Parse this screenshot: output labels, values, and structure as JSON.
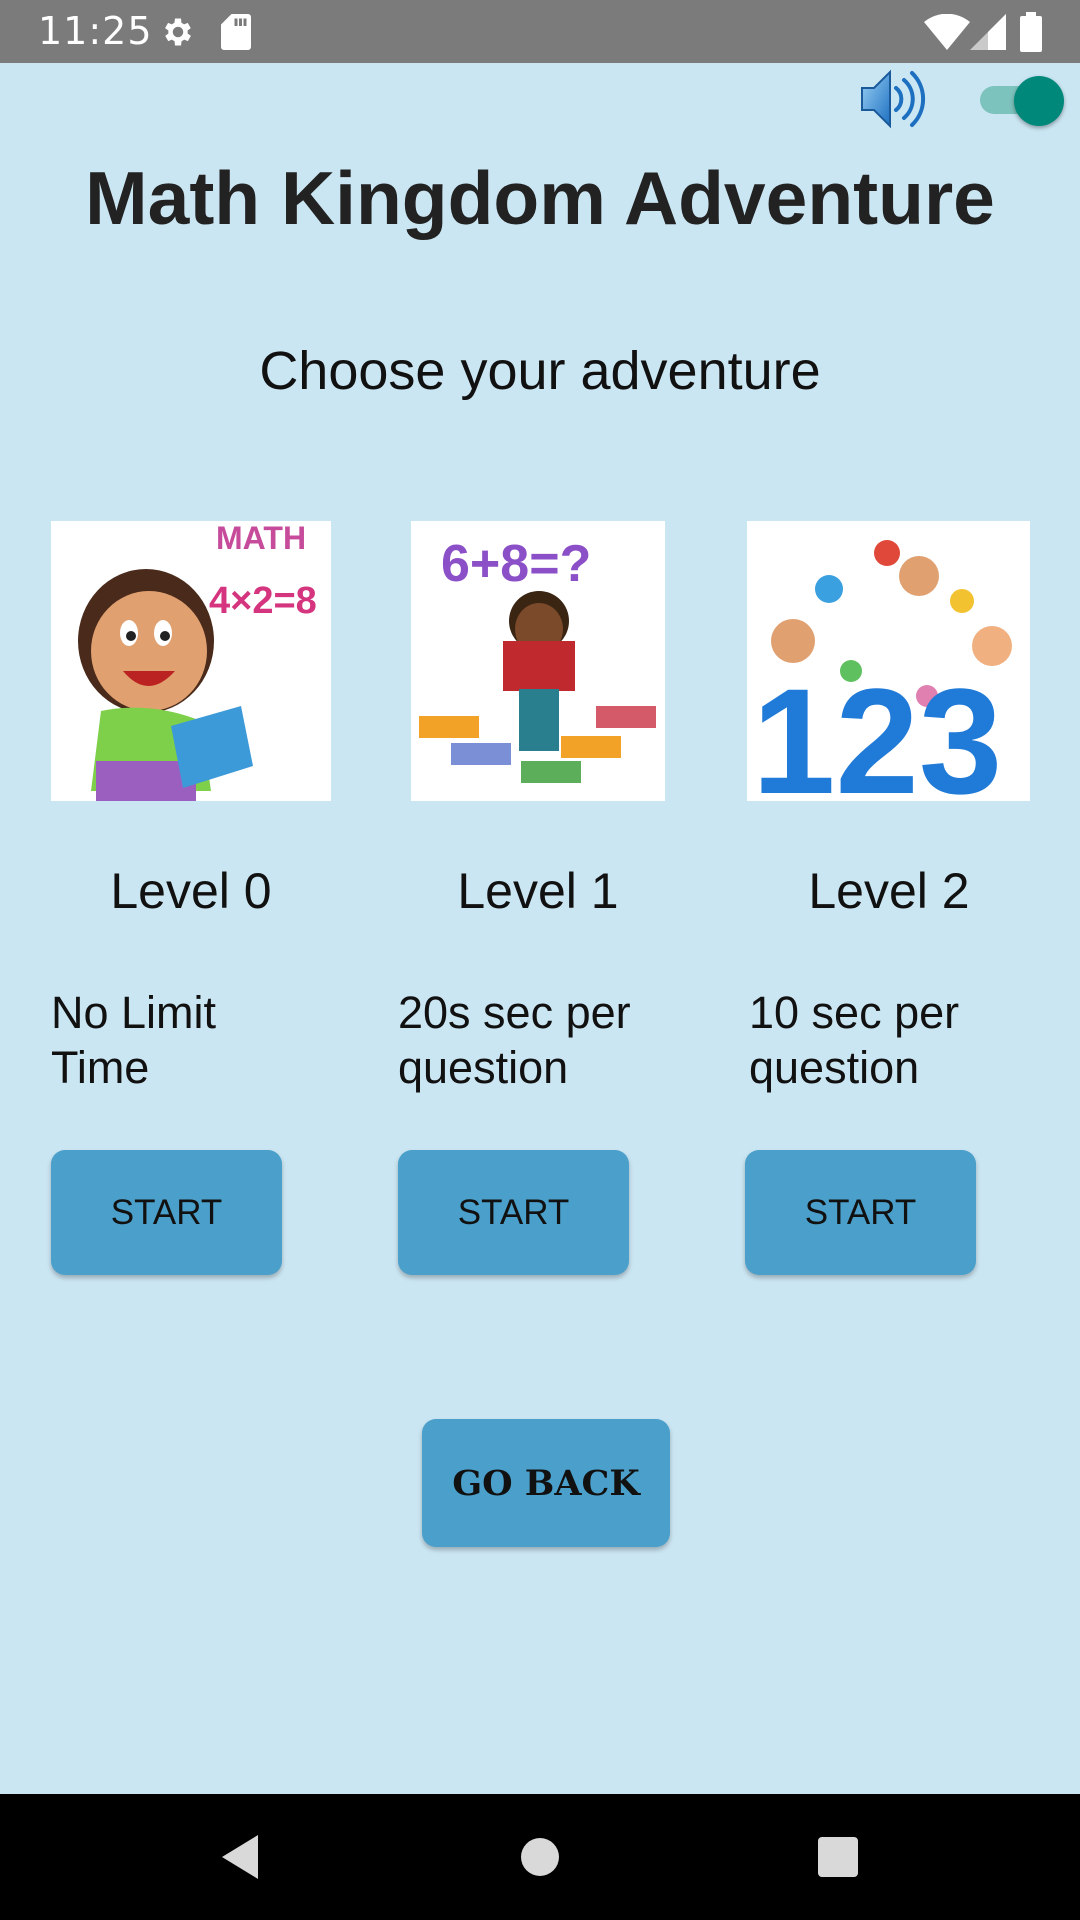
{
  "status_bar": {
    "time": "11:25",
    "icons": [
      "settings-icon",
      "sd-card-icon",
      "wifi-icon",
      "signal-icon",
      "battery-icon"
    ]
  },
  "controls": {
    "sound_icon": "speaker-icon",
    "sound_toggle_on": true,
    "accent_color": "#00897b"
  },
  "header": {
    "title": "Math Kingdom Adventure",
    "subtitle": "Choose your adventure"
  },
  "levels": [
    {
      "name": "Level 0",
      "description": "No Limit Time",
      "button": "START"
    },
    {
      "name": "Level 1",
      "description": "20s sec per question",
      "button": "START"
    },
    {
      "name": "Level 2",
      "description": "10 sec per question",
      "button": "START"
    }
  ],
  "footer": {
    "go_back_label": "GO BACK"
  },
  "images": {
    "level0_caption": "MATH",
    "level0_equation": "4×2=8",
    "level1_equation": "6+8=?",
    "level2_numbers": "123"
  },
  "colors": {
    "background": "#cbe6f3",
    "button": "#4aa0cb",
    "status_bar": "#7b7b7b"
  }
}
